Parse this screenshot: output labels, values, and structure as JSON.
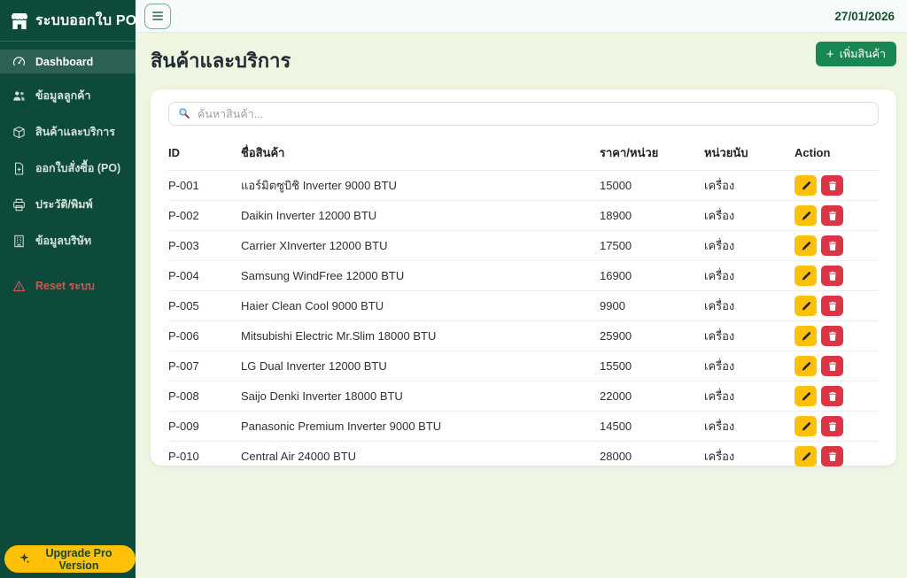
{
  "app": {
    "title": "ระบบออกใบ PO",
    "date": "27/01/2026",
    "upgrade_label": "Upgrade Pro Version"
  },
  "sidebar": {
    "items": [
      {
        "name": "sidebar-item-dashboard",
        "icon": "speedometer-icon",
        "label": "Dashboard",
        "active": true
      },
      {
        "name": "sidebar-item-customers",
        "icon": "people-icon",
        "label": "ข้อมูลลูกค้า",
        "active": false
      },
      {
        "name": "sidebar-item-products",
        "icon": "box-icon",
        "label": "สินค้าและบริการ",
        "active": false
      },
      {
        "name": "sidebar-item-po",
        "icon": "file-plus-icon",
        "label": "ออกใบสั่งซื้อ (PO)",
        "active": false
      },
      {
        "name": "sidebar-item-history-print",
        "icon": "printer-icon",
        "label": "ประวัติ/พิมพ์",
        "active": false
      },
      {
        "name": "sidebar-item-company",
        "icon": "building-icon",
        "label": "ข้อมูลบริษัท",
        "active": false
      },
      {
        "name": "sidebar-item-reset",
        "icon": "warning-icon",
        "label": "Reset ระบบ",
        "active": false,
        "danger": true
      }
    ]
  },
  "main": {
    "page_title": "สินค้าและบริการ",
    "add_button": {
      "plus_glyph": "+",
      "label": "เพิ่มสินค้า"
    }
  },
  "search": {
    "placeholder": "ค้นหาสินค้า..."
  },
  "table": {
    "headers": [
      "ID",
      "ชื่อสินค้า",
      "ราคา/หน่วย",
      "หน่วยนับ",
      "Action"
    ],
    "rows": [
      {
        "id": "P-001",
        "name": "แอร์มิตซูบิชิ Inverter 9000 BTU",
        "price": "15000",
        "unit": "เครื่อง"
      },
      {
        "id": "P-002",
        "name": "Daikin Inverter 12000 BTU",
        "price": "18900",
        "unit": "เครื่อง"
      },
      {
        "id": "P-003",
        "name": "Carrier XInverter 12000 BTU",
        "price": "17500",
        "unit": "เครื่อง"
      },
      {
        "id": "P-004",
        "name": "Samsung WindFree 12000 BTU",
        "price": "16900",
        "unit": "เครื่อง"
      },
      {
        "id": "P-005",
        "name": "Haier Clean Cool 9000 BTU",
        "price": "9900",
        "unit": "เครื่อง"
      },
      {
        "id": "P-006",
        "name": "Mitsubishi Electric Mr.Slim 18000 BTU",
        "price": "25900",
        "unit": "เครื่อง"
      },
      {
        "id": "P-007",
        "name": "LG Dual Inverter 12000 BTU",
        "price": "15500",
        "unit": "เครื่อง"
      },
      {
        "id": "P-008",
        "name": "Saijo Denki Inverter 18000 BTU",
        "price": "22000",
        "unit": "เครื่อง"
      },
      {
        "id": "P-009",
        "name": "Panasonic Premium Inverter 9000 BTU",
        "price": "14500",
        "unit": "เครื่อง"
      },
      {
        "id": "P-010",
        "name": "Central Air 24000 BTU",
        "price": "28000",
        "unit": "เครื่อง"
      }
    ],
    "action_icons": {
      "edit": "pencil-icon",
      "delete": "trash-icon"
    }
  },
  "colors": {
    "sidebar_green": "#0d4a3a",
    "accent_green": "#198754",
    "warning_yellow": "#ffc107",
    "danger_red": "#dc3545",
    "content_bg": "#eef6e2",
    "date_green": "#14532d"
  }
}
